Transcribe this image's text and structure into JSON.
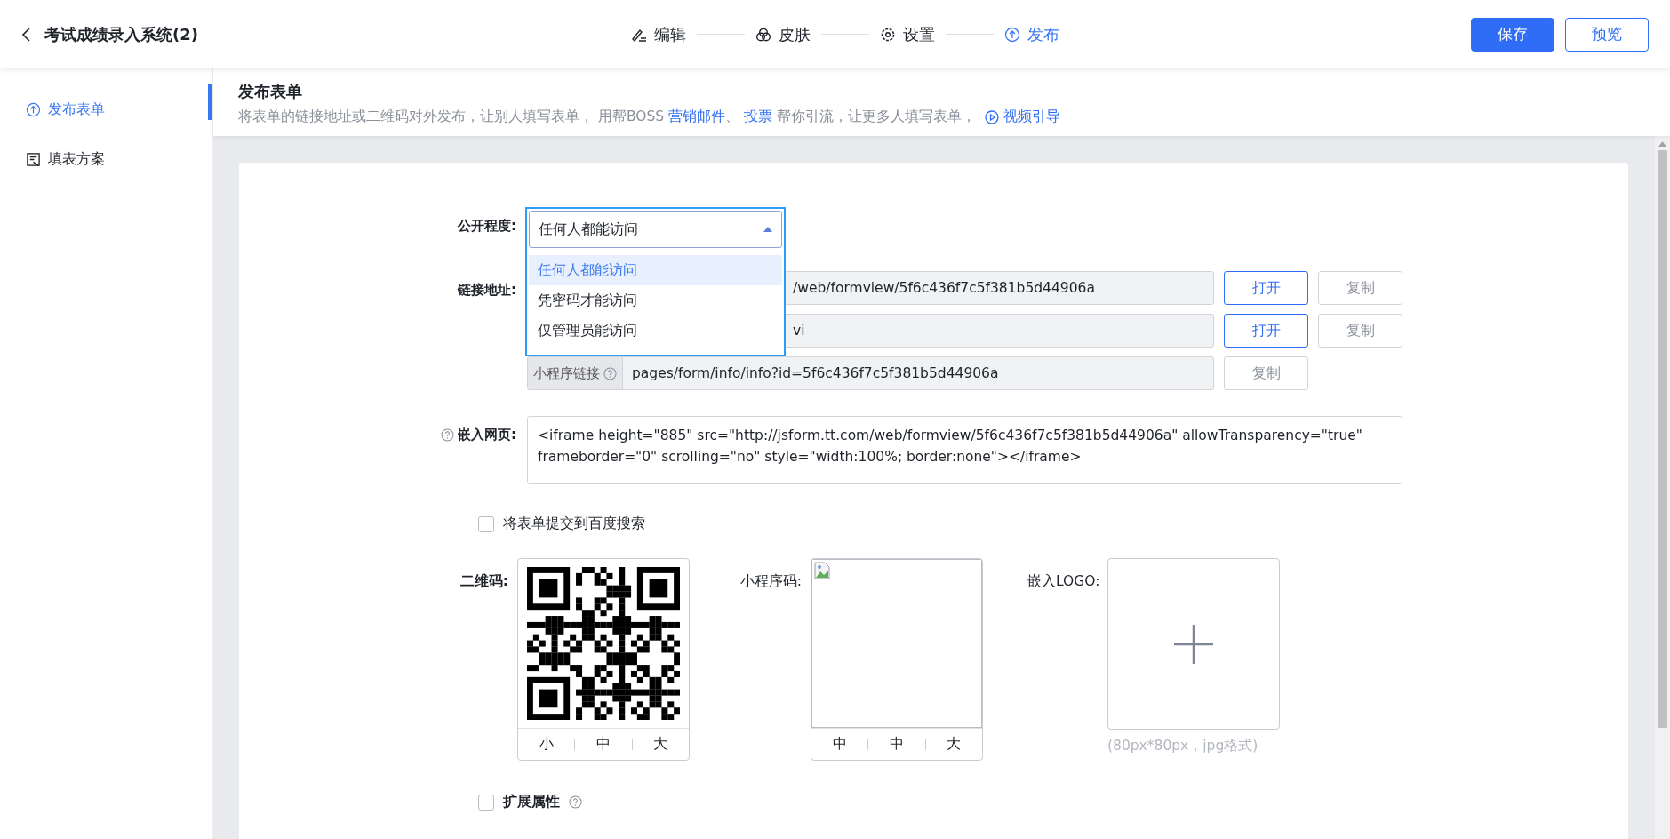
{
  "header": {
    "title": "考试成绩录入系统(2)",
    "steps": [
      {
        "label": "编辑",
        "kind": "edit",
        "selected": false
      },
      {
        "label": "皮肤",
        "kind": "skin",
        "selected": false
      },
      {
        "label": "设置",
        "kind": "settings",
        "selected": false
      },
      {
        "label": "发布",
        "kind": "publish",
        "selected": true
      }
    ],
    "actions": [
      {
        "label": "保存",
        "kind": "primary"
      },
      {
        "label": "预览",
        "kind": "outline"
      }
    ]
  },
  "sidebar": {
    "items": [
      {
        "label": "发布表单",
        "kind": "publish",
        "selected": true
      },
      {
        "label": "填表方案",
        "kind": "plan",
        "selected": false
      }
    ]
  },
  "page": {
    "title": "发布表单",
    "description": [
      {
        "text": "将表单的链接地址或二维码对外发布，让别人填写表单， 用帮BOSS ",
        "kind": "text"
      },
      {
        "text": "营销邮件",
        "kind": "link"
      },
      {
        "text": "、 ",
        "kind": "text"
      },
      {
        "text": "投票",
        "kind": "link"
      },
      {
        "text": " 帮你引流，让更多人填写表单，",
        "kind": "text"
      }
    ],
    "video_link": "视频引导"
  },
  "form": {
    "visibility": {
      "label": "公开程度:",
      "value": "任何人都能访问",
      "expanded": true,
      "options": [
        {
          "label": "任何人都能访问",
          "selected": true
        },
        {
          "label": "凭密码才能访问",
          "selected": false
        },
        {
          "label": "仅管理员能访问",
          "selected": false
        }
      ]
    },
    "links": {
      "label": "链接地址:",
      "rows": [
        {
          "value": "/web/formview/5f6c436f7c5f381b5d44906a",
          "buttons": [
            {
              "label": "打开",
              "kind": "primary"
            },
            {
              "label": "复制",
              "kind": "default"
            }
          ]
        },
        {
          "value": "vi",
          "buttons": [
            {
              "label": "打开",
              "kind": "primary"
            },
            {
              "label": "复制",
              "kind": "default"
            }
          ]
        },
        {
          "addon": "小程序链接",
          "value": "pages/form/info/info?id=5f6c436f7c5f381b5d44906a",
          "buttons": [
            {
              "label": "复制",
              "kind": "default"
            }
          ]
        }
      ]
    },
    "embed": {
      "label": "嵌入网页:",
      "code": "<iframe height=\"885\" src=\"http://jsform.tt.com/web/formview/5f6c436f7c5f381b5d44906a\" allowTransparency=\"true\" frameborder=\"0\" scrolling=\"no\" style=\"width:100%; border:none\"></iframe>"
    },
    "baidu": {
      "label": "将表单提交到百度搜索",
      "checked": false
    },
    "qr": {
      "label": "二维码:",
      "sizes": [
        "小",
        "中",
        "大"
      ]
    },
    "mini_code": {
      "label": "小程序码:",
      "sizes": [
        "中",
        "中",
        "大"
      ]
    },
    "logo": {
      "label": "嵌入LOGO:",
      "hint": "(80px*80px，jpg格式)"
    },
    "extended": {
      "label": "扩展属性",
      "checked": false
    }
  }
}
